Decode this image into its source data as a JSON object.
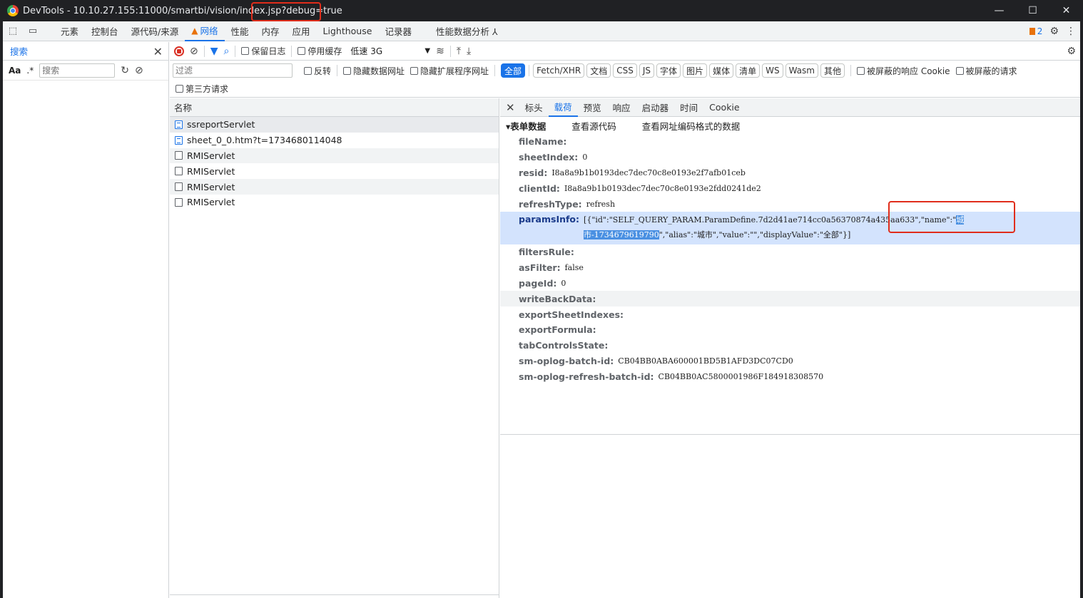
{
  "window": {
    "title": "DevTools - 10.10.27.155:11000/smartbi/vision/index.jsp?debug=true",
    "controls": [
      "—",
      "☐",
      "✕"
    ]
  },
  "tabs": [
    {
      "label": "元素"
    },
    {
      "label": "控制台"
    },
    {
      "label": "源代码/来源"
    },
    {
      "label": "网络",
      "warning": "▲"
    },
    {
      "label": "性能"
    },
    {
      "label": "内存"
    },
    {
      "label": "应用"
    },
    {
      "label": "Lighthouse"
    },
    {
      "label": "记录器"
    },
    {
      "label": "性能数据分析 ⅄"
    }
  ],
  "issues_count": "2",
  "search_panel": {
    "title": "搜索",
    "aa_label": "Aa",
    "regex_label": ".*",
    "placeholder": "搜索"
  },
  "network_toolbar": {
    "preserve_log": "保留日志",
    "disable_cache": "停用缓存",
    "throttle": "低速 3G",
    "filter_placeholder": "过滤",
    "invert": "反转",
    "hide_data_urls": "隐藏数据网址",
    "hide_extension_urls": "隐藏扩展程序网址",
    "type_chips": [
      "全部",
      "Fetch/XHR",
      "文档",
      "CSS",
      "JS",
      "字体",
      "图片",
      "媒体",
      "清单",
      "WS",
      "Wasm",
      "其他"
    ],
    "blocked_cookies": "被屏蔽的响应 Cookie",
    "blocked_requests": "被屏蔽的请求",
    "third_party": "第三方请求"
  },
  "request_list": {
    "header": "名称",
    "rows": [
      {
        "name": "ssreportServlet",
        "icon": "document-icon"
      },
      {
        "name": "sheet_0_0.htm?t=1734680114048",
        "icon": "document-icon"
      },
      {
        "name": "RMIServlet",
        "icon": "file-icon"
      },
      {
        "name": "RMIServlet",
        "icon": "file-icon"
      },
      {
        "name": "RMIServlet",
        "icon": "file-icon"
      },
      {
        "name": "RMIServlet",
        "icon": "file-icon"
      }
    ]
  },
  "detail": {
    "tabs": [
      "标头",
      "载荷",
      "预览",
      "响应",
      "启动器",
      "时间",
      "Cookie"
    ],
    "form_section": "▾表单数据",
    "view_source": "查看源代码",
    "view_url_encoded": "查看网址编码格式的数据",
    "fields": [
      {
        "key": "fileName:",
        "value": ""
      },
      {
        "key": "sheetIndex:",
        "value": "0"
      },
      {
        "key": "resid:",
        "value": "I8a8a9b1b0193dec7dec70c8e0193e2f7afb01ceb"
      },
      {
        "key": "clientId:",
        "value": "I8a8a9b1b0193dec7dec70c8e0193e2fdd0241de2"
      },
      {
        "key": "refreshType:",
        "value": "refresh"
      }
    ],
    "params": {
      "key": "paramsInfo:",
      "value_a": "[{\"id\":\"SELF_QUERY_PARAM.ParamDefine.7d2d41ae714cc0a56370874a435aa633\",\"name\":\"",
      "value_sel": "城市-1734679619790",
      "value_b": "\",\"alias\":\"城市\",\"value\":\"\",\"displayValue\":\"全部\"}]"
    },
    "fields2": [
      {
        "key": "filtersRule:",
        "value": ""
      },
      {
        "key": "asFilter:",
        "value": "false"
      },
      {
        "key": "pageId:",
        "value": "0"
      },
      {
        "key": "writeBackData:",
        "value": ""
      },
      {
        "key": "exportSheetIndexes:",
        "value": ""
      },
      {
        "key": "exportFormula:",
        "value": ""
      },
      {
        "key": "tabControlsState:",
        "value": ""
      },
      {
        "key": "sm-oplog-batch-id:",
        "value": "CB04BB0ABA600001BD5B1AFD3DC07CD0"
      },
      {
        "key": "sm-oplog-refresh-batch-id:",
        "value": "CB04BB0AC5800001986F184918308570"
      }
    ]
  },
  "colors": {
    "accent": "#1a73e8",
    "annotation": "#e02d1b",
    "selection": "#d3e3fd"
  }
}
